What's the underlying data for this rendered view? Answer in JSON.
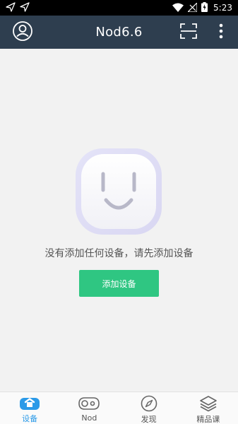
{
  "status_bar": {
    "time": "5:23",
    "icons": [
      "send-icon",
      "navigation-icon",
      "wifi-icon",
      "no-signal-icon",
      "battery-charging-icon"
    ]
  },
  "app_bar": {
    "title": "Nod6.6",
    "left_icon": "user-icon",
    "right_icons": [
      "scan-icon",
      "more-vert-icon"
    ]
  },
  "empty_state": {
    "icon": "smiley-face-icon",
    "message": "没有添加任何设备，请先添加设备",
    "button_label": "添加设备"
  },
  "bottom_nav": {
    "items": [
      {
        "label": "设备",
        "icon": "device-icon",
        "active": true
      },
      {
        "label": "Nod",
        "icon": "nod-icon",
        "active": false
      },
      {
        "label": "发现",
        "icon": "compass-icon",
        "active": false
      },
      {
        "label": "精品课",
        "icon": "layers-icon",
        "active": false
      }
    ]
  },
  "colors": {
    "app_bar": "#2e3e4f",
    "accent_green": "#2fc682",
    "active_blue": "#2b9ae8",
    "background": "#f2f2f2"
  }
}
